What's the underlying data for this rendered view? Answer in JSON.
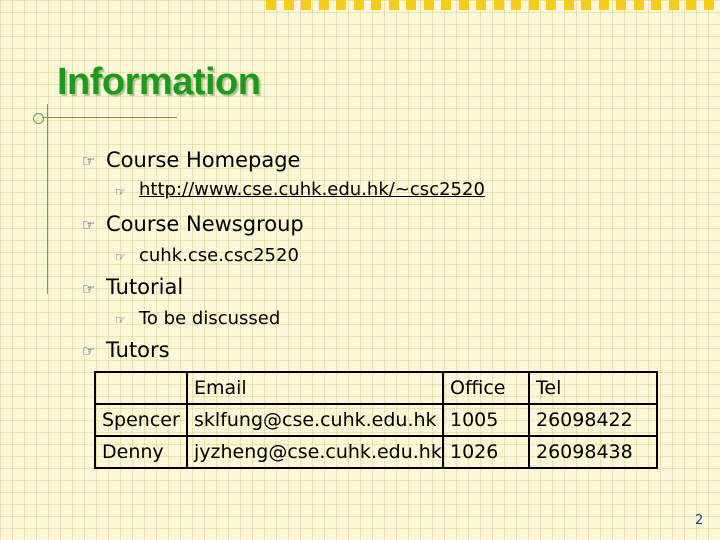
{
  "slide": {
    "title": "Information",
    "page_number": "2",
    "bullets": {
      "course_homepage": {
        "label": "Course Homepage",
        "sub": "http://www.cse.cuhk.edu.hk/~csc2520"
      },
      "course_newsgroup": {
        "label": "Course Newsgroup",
        "sub": "cuhk.cse.csc2520"
      },
      "tutorial": {
        "label": "Tutorial",
        "sub": "To be discussed"
      },
      "tutors": {
        "label": "Tutors"
      }
    },
    "bullet_icon": "pointing-hand-icon",
    "colors": {
      "title": "#1d9a1d",
      "background": "#fbf7d8",
      "accent_blocks": "#f4cd1c"
    }
  },
  "tutors_table": {
    "headers": [
      "",
      "Email",
      "Office",
      "Tel"
    ],
    "rows": [
      [
        "Spencer",
        "sklfung@cse.cuhk.edu.hk",
        "1005",
        "26098422"
      ],
      [
        "Denny",
        "jyzheng@cse.cuhk.edu.hk",
        "1026",
        "26098438"
      ]
    ]
  }
}
